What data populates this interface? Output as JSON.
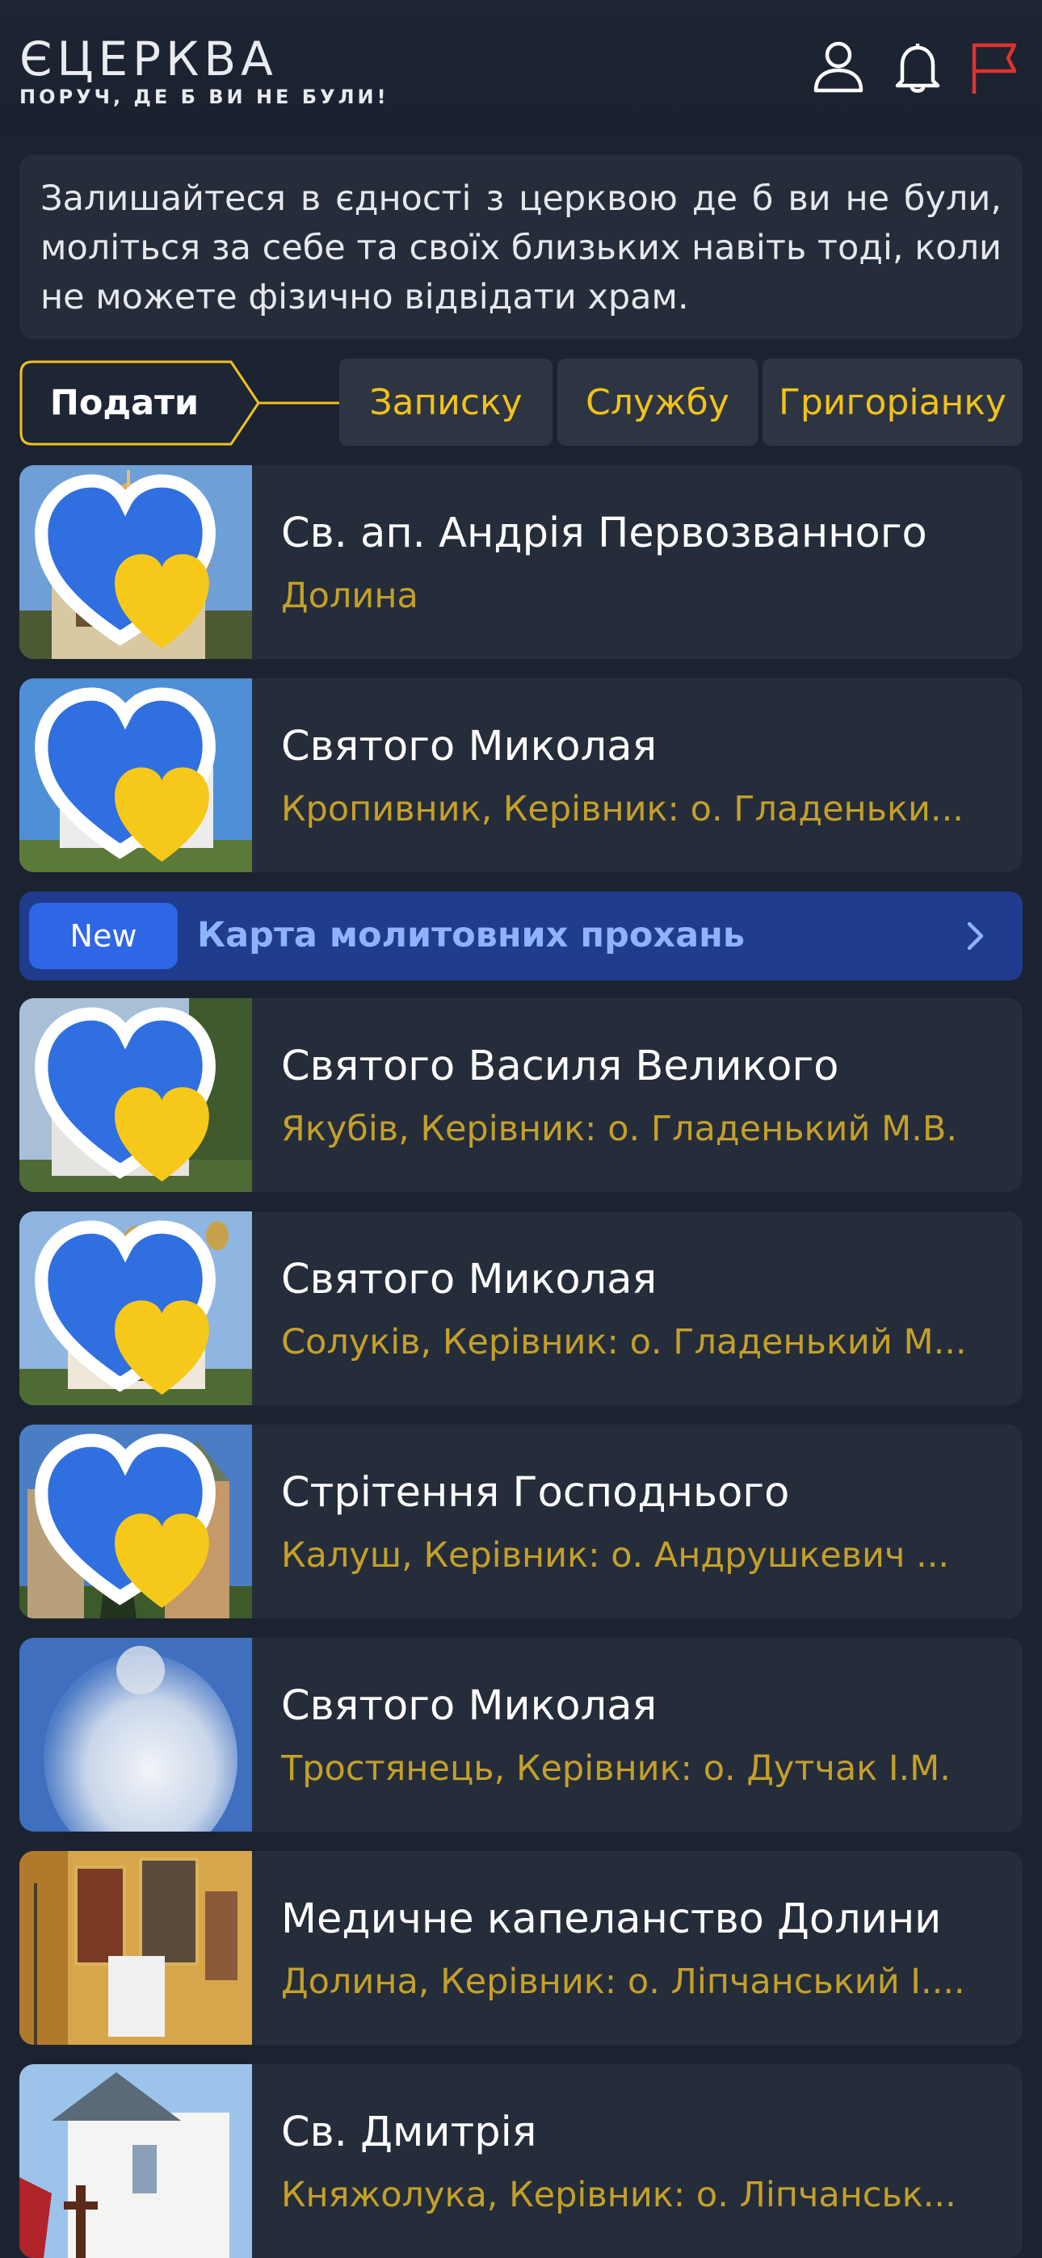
{
  "header": {
    "logo_title": "ЄЦЕРКВА",
    "logo_subtitle": "ПОРУЧ, ДЕ Б ВИ НЕ БУЛИ!",
    "icons": [
      "user-icon",
      "bell-icon",
      "flag-icon"
    ]
  },
  "intro": {
    "text": "Залишайтеся в єдності з церквою де б ви не були, моліться за себе та своїх близьких навіть тоді, коли не можете фізично відвідати храм."
  },
  "tabs": {
    "submit_label": "Подати",
    "items": [
      "Записку",
      "Службу",
      "Григоріанку"
    ]
  },
  "banner": {
    "badge": "New",
    "text": "Карта молитовних прохань"
  },
  "churches": [
    {
      "name": "Св. ап. Андрія Первозванного",
      "subtitle": "Долина",
      "badge": true
    },
    {
      "name": "Святого Миколая",
      "subtitle": "Кропивник, Керівник: о. Гладеньки...",
      "badge": true
    },
    {
      "name": "Святого Василя Великого",
      "subtitle": "Якубів, Керівник: о. Гладенький М.В.",
      "badge": true
    },
    {
      "name": "Святого Миколая",
      "subtitle": "Солуків, Керівник: о. Гладенький М...",
      "badge": true
    },
    {
      "name": "Стрітення Господнього",
      "subtitle": "Калуш, Керівник: о. Андрушкевич ...",
      "badge": true
    },
    {
      "name": "Святого Миколая",
      "subtitle": "Тростянець, Керівник: о. Дутчак І.М.",
      "badge": false
    },
    {
      "name": "Медичне капеланство Долини",
      "subtitle": "Долина, Керівник: о. Ліпчанський І....",
      "badge": false
    },
    {
      "name": "Св. Дмитрія",
      "subtitle": "Княжолука, Керівник: о. Ліпчанськ...",
      "badge": false
    }
  ],
  "colors": {
    "background": "#1b2331",
    "card": "#252d3a",
    "accent_yellow": "#f2c21a",
    "subtitle_gold": "#c4a02a",
    "banner_blue": "#1f3c8e",
    "badge_blue": "#2f66e6",
    "flag_red": "#e0322e"
  }
}
